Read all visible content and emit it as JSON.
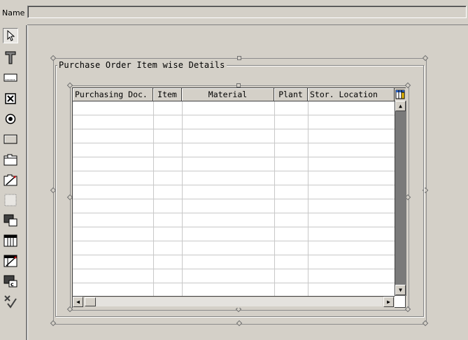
{
  "header": {
    "name_label": "Name",
    "name_value": ""
  },
  "toolbar": {
    "tools": [
      {
        "icon": "pointer-icon"
      },
      {
        "icon": "text-icon"
      },
      {
        "icon": "input-field-icon"
      },
      {
        "icon": "checkbox-icon"
      },
      {
        "icon": "radio-button-icon"
      },
      {
        "icon": "pushbutton-icon"
      },
      {
        "icon": "tabstrip-icon"
      },
      {
        "icon": "tabstrip-wizard-icon"
      },
      {
        "icon": "box-icon"
      },
      {
        "icon": "subscreen-icon"
      },
      {
        "icon": "table-control-icon"
      },
      {
        "icon": "table-wizard-icon"
      },
      {
        "icon": "custom-control-icon"
      },
      {
        "icon": "status-icon"
      }
    ]
  },
  "frame": {
    "title": "Purchase Order Item wise Details"
  },
  "table": {
    "columns": [
      "Purchasing Doc.",
      "Item",
      "Material",
      "Plant",
      "Stor. Location"
    ],
    "row_count": 14
  },
  "colors": {
    "background": "#d4d0c8",
    "scroll_track": "#7a7a7a"
  }
}
